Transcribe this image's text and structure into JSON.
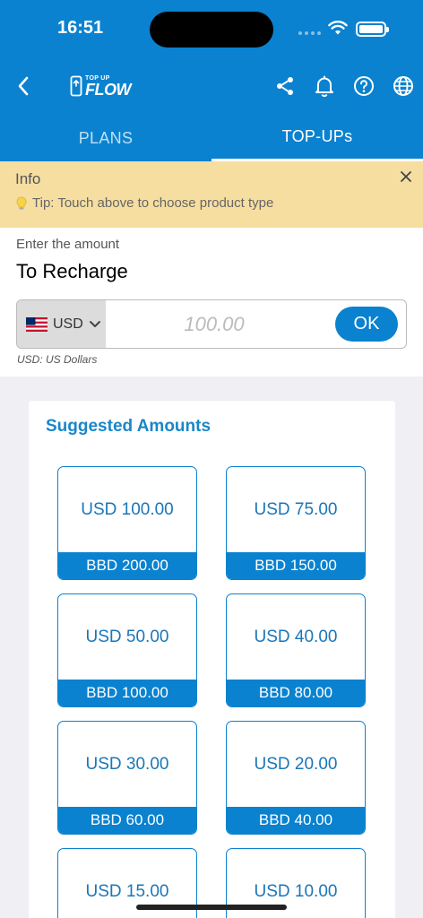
{
  "status_bar": {
    "time": "16:51"
  },
  "header": {
    "logo_small": "TOP UP",
    "logo_big": "FLOW",
    "icons": [
      "back-icon",
      "share-icon",
      "bell-icon",
      "help-icon",
      "globe-icon"
    ]
  },
  "tabs": [
    {
      "label": "PLANS",
      "active": false
    },
    {
      "label": "TOP-UPs",
      "active": true
    }
  ],
  "info": {
    "title": "Info",
    "tip": "Tip: Touch above to choose product type"
  },
  "amount": {
    "label": "Enter the amount",
    "title": "To Recharge",
    "currency": "USD",
    "placeholder": "100.00",
    "ok_label": "OK",
    "currency_note": "USD: US Dollars"
  },
  "suggested": {
    "title": "Suggested Amounts",
    "items": [
      {
        "usd": "USD 100.00",
        "local": "BBD 200.00"
      },
      {
        "usd": "USD 75.00",
        "local": "BBD 150.00"
      },
      {
        "usd": "USD 50.00",
        "local": "BBD 100.00"
      },
      {
        "usd": "USD 40.00",
        "local": "BBD 80.00"
      },
      {
        "usd": "USD 30.00",
        "local": "BBD 60.00"
      },
      {
        "usd": "USD 20.00",
        "local": "BBD 40.00"
      },
      {
        "usd": "USD 15.00",
        "local": ""
      },
      {
        "usd": "USD 10.00",
        "local": ""
      }
    ]
  },
  "colors": {
    "primary": "#0a82cf",
    "banner": "#f5dea0",
    "background": "#efeff4"
  }
}
